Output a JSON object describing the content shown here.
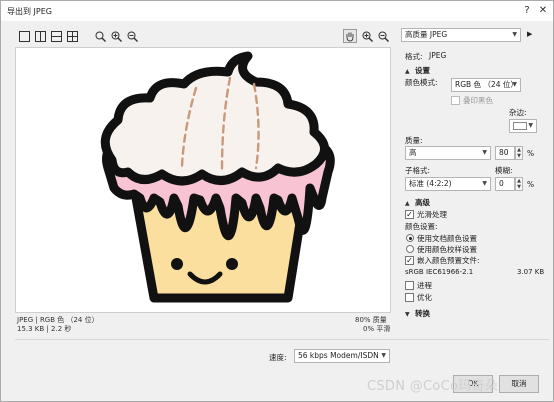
{
  "window": {
    "title": "导出到 JPEG",
    "help": "?",
    "close": "✕"
  },
  "toolbar": {
    "icons": [
      "single-view-icon",
      "split-vertical-icon",
      "split-horizontal-icon",
      "quad-view-icon",
      "zoom-fit-icon",
      "zoom-in-icon",
      "zoom-out-icon",
      "hand-icon",
      "zoom-in-icon",
      "zoom-out-icon"
    ]
  },
  "preview": {
    "info_left_line1": "JPEG | RGB 色 （24 位）",
    "info_left_line2": "15.3 KB | 2.2 秒",
    "info_right_line1": "80% 质量",
    "info_right_line2": "0% 平滑"
  },
  "panel": {
    "preset_value": "高质量 JPEG",
    "format_label": "格式:",
    "format_value": "JPEG",
    "settings_header": "设置",
    "color_mode_label": "颜色模式:",
    "color_mode_value": "RGB 色 （24 位）",
    "overprint_label": "叠印黑色",
    "matte_label": "杂边:",
    "quality_label": "质量:",
    "quality_value": "高",
    "quality_number": "80",
    "percent": "%",
    "subformat_label": "子格式:",
    "blur_label": "模糊:",
    "subformat_value": "标准 (4:2:2)",
    "blur_number": "0",
    "advanced_header": "高级",
    "antialias_label": "光滑处理",
    "color_settings_label": "颜色设置:",
    "use_doc_colors_label": "使用文档颜色设置",
    "use_proof_colors_label": "使用颜色校样设置",
    "embed_profile_label": "嵌入颜色预置文件:",
    "profile_name": "sRGB IEC61966-2.1",
    "profile_size": "3.07 KB",
    "progressive_label": "进程",
    "optimize_label": "优化",
    "transform_header": "转换"
  },
  "bottom": {
    "speed_label": "速度:",
    "speed_value": "56 kbps Modem/ISDN",
    "ok_label": "OK",
    "cancel_label": "取消"
  },
  "watermark": "CSDN @CoCo玛奇朵",
  "colors": {
    "frosting": "#f7f2ed",
    "glaze": "#f8c3d3",
    "cake": "#fadf9e",
    "outline": "#111111",
    "sprinkle": "#c9997b"
  }
}
